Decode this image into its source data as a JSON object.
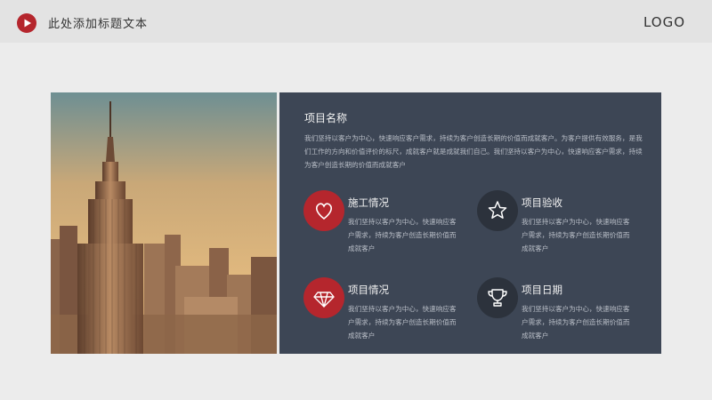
{
  "header": {
    "title": "此处添加标题文本",
    "logo": "LOGO",
    "accent_color": "#b5262d"
  },
  "image": {
    "description_icon": "empire-state-building-photo"
  },
  "panel": {
    "title": "项目名称",
    "description": "我们坚持以客户为中心，快速响应客户需求，持续为客户创造长期的价值而成就客户。为客户提供有效服务，是我们工作的方向和价值评价的标尺，成就客户就是成就我们自己。我们坚持以客户为中心，快速响应客户需求，持续为客户创造长期的价值而成就客户",
    "background_color": "#3d4655"
  },
  "features": [
    {
      "title": "施工情况",
      "text": "我们坚持以客户为中心，快速响应客户需求，持续为客户创造长期价值而成就客户",
      "icon": "heart-icon",
      "color": "#b5262d"
    },
    {
      "title": "项目验收",
      "text": "我们坚持以客户为中心，快速响应客户需求，持续为客户创造长期价值而成就客户",
      "icon": "star-icon",
      "color": "#2c323c"
    },
    {
      "title": "项目情况",
      "text": "我们坚持以客户为中心，快速响应客户需求，持续为客户创造长期价值而成就客户",
      "icon": "diamond-icon",
      "color": "#b5262d"
    },
    {
      "title": "项目日期",
      "text": "我们坚持以客户为中心，快速响应客户需求，持续为客户创造长期价值而成就客户",
      "icon": "trophy-icon",
      "color": "#2c323c"
    }
  ]
}
